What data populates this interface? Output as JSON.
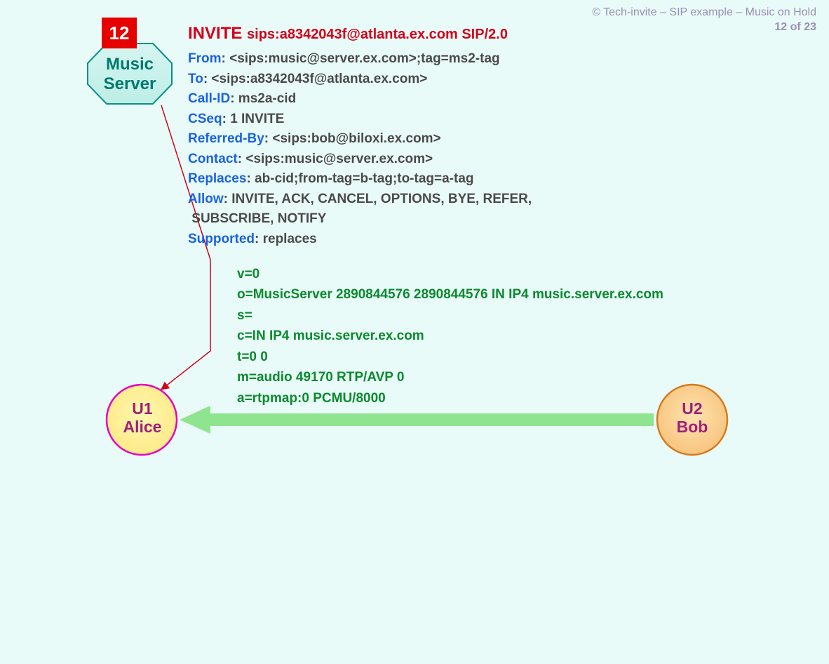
{
  "credit": {
    "text": "© Tech-invite – SIP example – Music on Hold",
    "page": "12 of 23"
  },
  "step": "12",
  "nodes": {
    "music": "Music\nServer",
    "alice": "U1\nAlice",
    "bob": "U2\nBob"
  },
  "request": {
    "method": "INVITE",
    "uri": "sips:a8342043f@atlanta.ex.com SIP/2.0"
  },
  "headers": {
    "from": {
      "name": "From",
      "value": "<sips:music@server.ex.com>;tag=ms2-tag"
    },
    "to": {
      "name": "To",
      "value": "<sips:a8342043f@atlanta.ex.com>"
    },
    "callid": {
      "name": "Call-ID",
      "value": "ms2a-cid"
    },
    "cseq": {
      "name": "CSeq",
      "value": "1 INVITE"
    },
    "referredby": {
      "name": "Referred-By",
      "value": "<sips:bob@biloxi.ex.com>"
    },
    "contact": {
      "name": "Contact",
      "value": "<sips:music@server.ex.com>"
    },
    "replaces": {
      "name": "Replaces",
      "value": "ab-cid;from-tag=b-tag;to-tag=a-tag"
    },
    "allow": {
      "name": "Allow",
      "value": "INVITE, ACK, CANCEL, OPTIONS, BYE, REFER,"
    },
    "allow_cont": "SUBSCRIBE, NOTIFY",
    "supported": {
      "name": "Supported",
      "value": "replaces"
    }
  },
  "sdp": {
    "l1": "v=0",
    "l2": "o=MusicServer  2890844576  2890844576  IN  IP4  music.server.ex.com",
    "l3": "s=",
    "l4": "c=IN IP4 music.server.ex.com",
    "l5": "t=0 0",
    "l6": "m=audio 49170 RTP/AVP 0",
    "l7": "a=rtpmap:0 PCMU/8000"
  }
}
